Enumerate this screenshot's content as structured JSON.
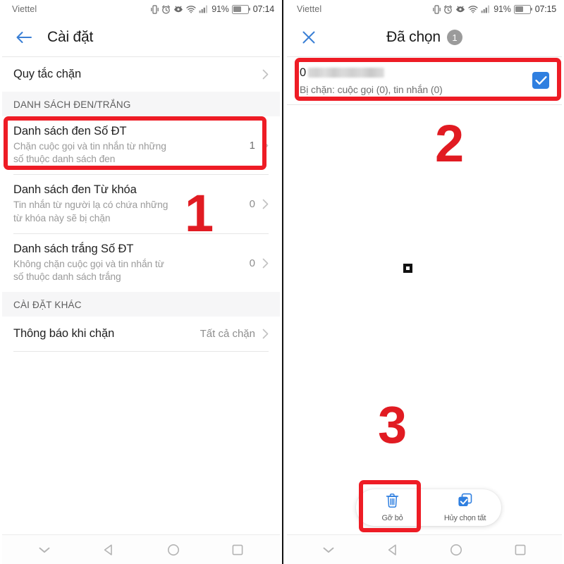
{
  "left": {
    "status": {
      "carrier": "Viettel",
      "battery_percent": "91%",
      "time": "07:14",
      "icons": [
        "vibrate-icon",
        "alarm-icon",
        "eye-comfort-icon",
        "wifi-icon",
        "signal-icon",
        "battery-icon"
      ]
    },
    "appbar": {
      "back_icon": "arrow-left-icon",
      "title": "Cài đặt"
    },
    "rows_top": [
      {
        "title": "Quy tắc chặn",
        "subtitle": "",
        "value": "",
        "chevron": true
      }
    ],
    "section_blacklist": {
      "header": "DANH SÁCH ĐEN/TRẮNG",
      "rows": [
        {
          "title": "Danh sách đen Số ĐT",
          "subtitle": "Chặn cuộc gọi và tin nhắn từ những\nsố thuộc danh sách đen",
          "value": "1",
          "chevron": true
        },
        {
          "title": "Danh sách đen Từ khóa",
          "subtitle": "Tin nhắn từ người lạ có chứa những\ntừ khóa này sẽ bị chặn",
          "value": "0",
          "chevron": true
        },
        {
          "title": "Danh sách trắng Số ĐT",
          "subtitle": "Không chặn cuộc gọi và tin nhắn từ\nsố thuộc danh sách trắng",
          "value": "0",
          "chevron": true
        }
      ]
    },
    "section_other": {
      "header": "CÀI ĐẶT KHÁC",
      "rows": [
        {
          "title": "Thông báo khi chặn",
          "subtitle": "",
          "value": "Tất cả chặn",
          "chevron": true
        }
      ]
    }
  },
  "right": {
    "status": {
      "carrier": "Viettel",
      "battery_percent": "91%",
      "time": "07:15",
      "icons": [
        "vibrate-icon",
        "alarm-icon",
        "eye-comfort-icon",
        "wifi-icon",
        "signal-icon",
        "battery-icon"
      ]
    },
    "appbar": {
      "close_icon": "close-icon",
      "title": "Đã chọn",
      "count": "1"
    },
    "contact": {
      "number_prefix": "0",
      "number_masked": true,
      "blocked_info": "Bị chặn: cuộc gọi (0), tin nhắn (0)",
      "checkbox_icon": "checkbox-checked-icon",
      "checked": true
    },
    "actions": [
      {
        "label": "Gỡ bỏ",
        "icon": "trash-icon"
      },
      {
        "label": "Hủy chọn tất",
        "icon": "deselect-all-icon"
      }
    ]
  },
  "navbar": {
    "buttons": [
      "chevron-down-icon",
      "back-triangle-icon",
      "home-circle-icon",
      "recents-square-icon"
    ]
  },
  "annotations": {
    "steps": [
      "1",
      "2",
      "3"
    ],
    "highlight_color": "#ee1c25",
    "number_color": "#e11b22"
  },
  "colors": {
    "accent_blue": "#2f7fe0",
    "link_blue": "#3a7fd5",
    "section_bg": "#f6f6f7",
    "text_primary": "#1f1f1f",
    "text_secondary": "#9a9a9a"
  }
}
